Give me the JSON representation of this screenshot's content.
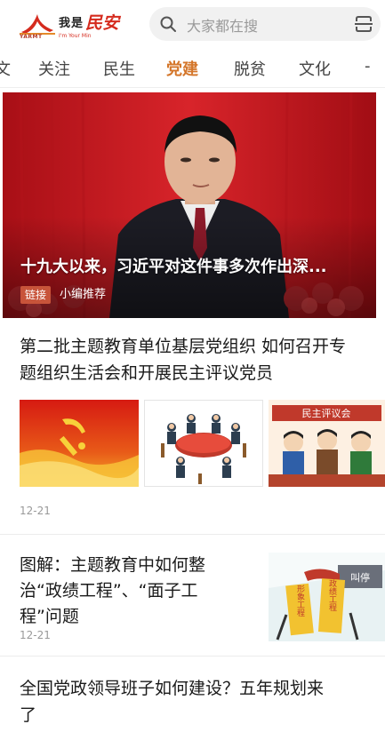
{
  "header": {
    "logo_cn": "我是",
    "logo_red": "民安",
    "logo_en": "YARMT",
    "logo_sub": "I'm Your Min",
    "search_placeholder": "大家都在搜"
  },
  "tabs": [
    {
      "label": "文",
      "active": false
    },
    {
      "label": "关注",
      "active": false
    },
    {
      "label": "民生",
      "active": false
    },
    {
      "label": "党建",
      "active": true
    },
    {
      "label": "脱贫",
      "active": false
    },
    {
      "label": "文化",
      "active": false
    }
  ],
  "tab_more": "-",
  "hero": {
    "title": "十九大以来，习近平对这件事多次作出深...",
    "badge": "链接",
    "tag": "小编推荐"
  },
  "articles": [
    {
      "title_line1": "第二批主题教育单位基层党组织 如何召开专",
      "title_line2": "题组织生活会和开展民主评议党员",
      "thumb3_banner": "民主评议会",
      "date": "12-21"
    },
    {
      "title_line1": "图解：主题教育中如何整",
      "title_line2": "治“政绩工程”、“面子工",
      "title_line3": "程”问题",
      "date": "12-21",
      "thumb_sign1": "形象工程",
      "thumb_sign2": "政绩工程",
      "thumb_stop": "叫停"
    },
    {
      "title_line1": "全国党政领导班子如何建设？五年规划来",
      "title_line2": "了"
    }
  ],
  "colors": {
    "accent": "#d4762a",
    "brand_red": "#d52b1e",
    "badge": "#c8543a"
  }
}
